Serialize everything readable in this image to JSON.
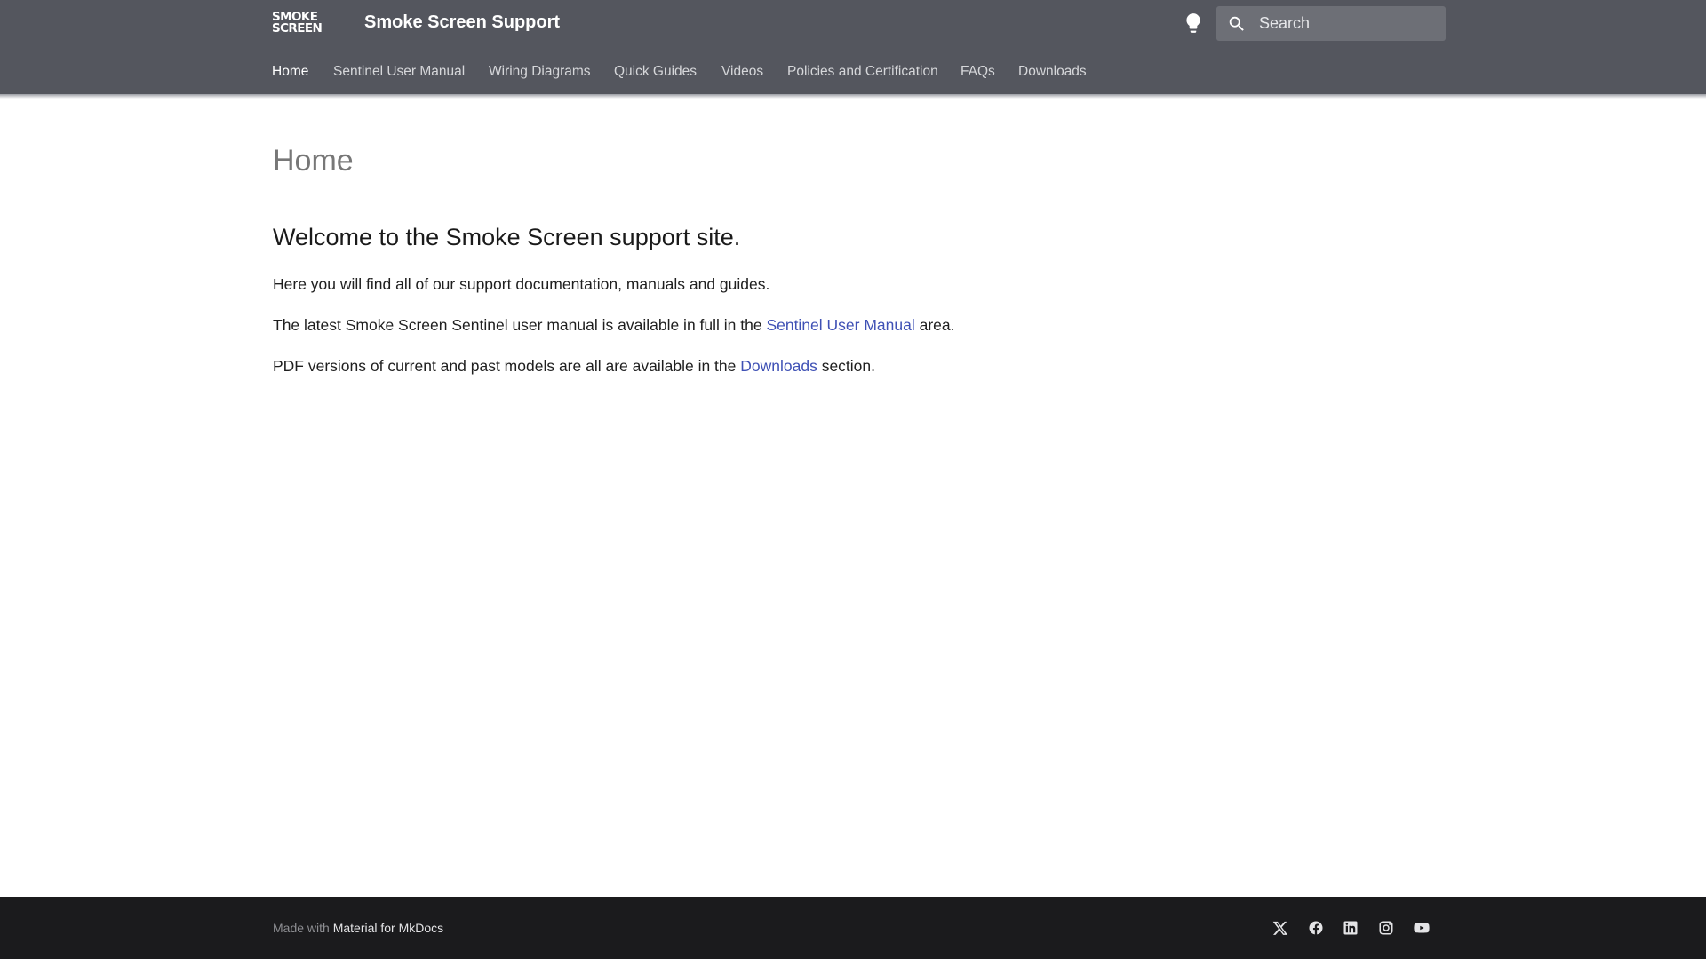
{
  "header": {
    "logo_line1": "SMOKE",
    "logo_line2": "SCREEN",
    "site_title": "Smoke Screen Support",
    "palette_toggle_icon": "lightbulb-icon",
    "search": {
      "placeholder": "Search",
      "value": "",
      "icon": "search-icon"
    }
  },
  "tabs": [
    {
      "label": "Home",
      "active": true
    },
    {
      "label": "Sentinel User Manual",
      "active": false
    },
    {
      "label": "Wiring Diagrams",
      "active": false
    },
    {
      "label": "Quick Guides",
      "active": false
    },
    {
      "label": "Videos",
      "active": false
    },
    {
      "label": "Policies and Certification",
      "active": false
    },
    {
      "label": "FAQs",
      "active": false
    },
    {
      "label": "Downloads",
      "active": false
    }
  ],
  "main": {
    "page_title": "Home",
    "welcome_heading": "Welcome to the Smoke Screen support site.",
    "p1": "Here you will find all of our support documentation, manuals and guides.",
    "p2_before": "The latest Smoke Screen Sentinel user manual is available in full in the ",
    "p2_link": "Sentinel User Manual",
    "p2_after": " area.",
    "p3_before": "PDF versions of current and past models are all are available in the ",
    "p3_link": "Downloads",
    "p3_after": " section."
  },
  "footer": {
    "made_with_prefix": "Made with ",
    "made_with_link": "Material for MkDocs",
    "social_icons": [
      "x-twitter-icon",
      "facebook-icon",
      "linkedin-icon",
      "instagram-icon",
      "youtube-icon"
    ]
  },
  "colors": {
    "header_bg": "#54565e",
    "link": "#3f51b5",
    "footer_bg": "#1b1b1d"
  }
}
